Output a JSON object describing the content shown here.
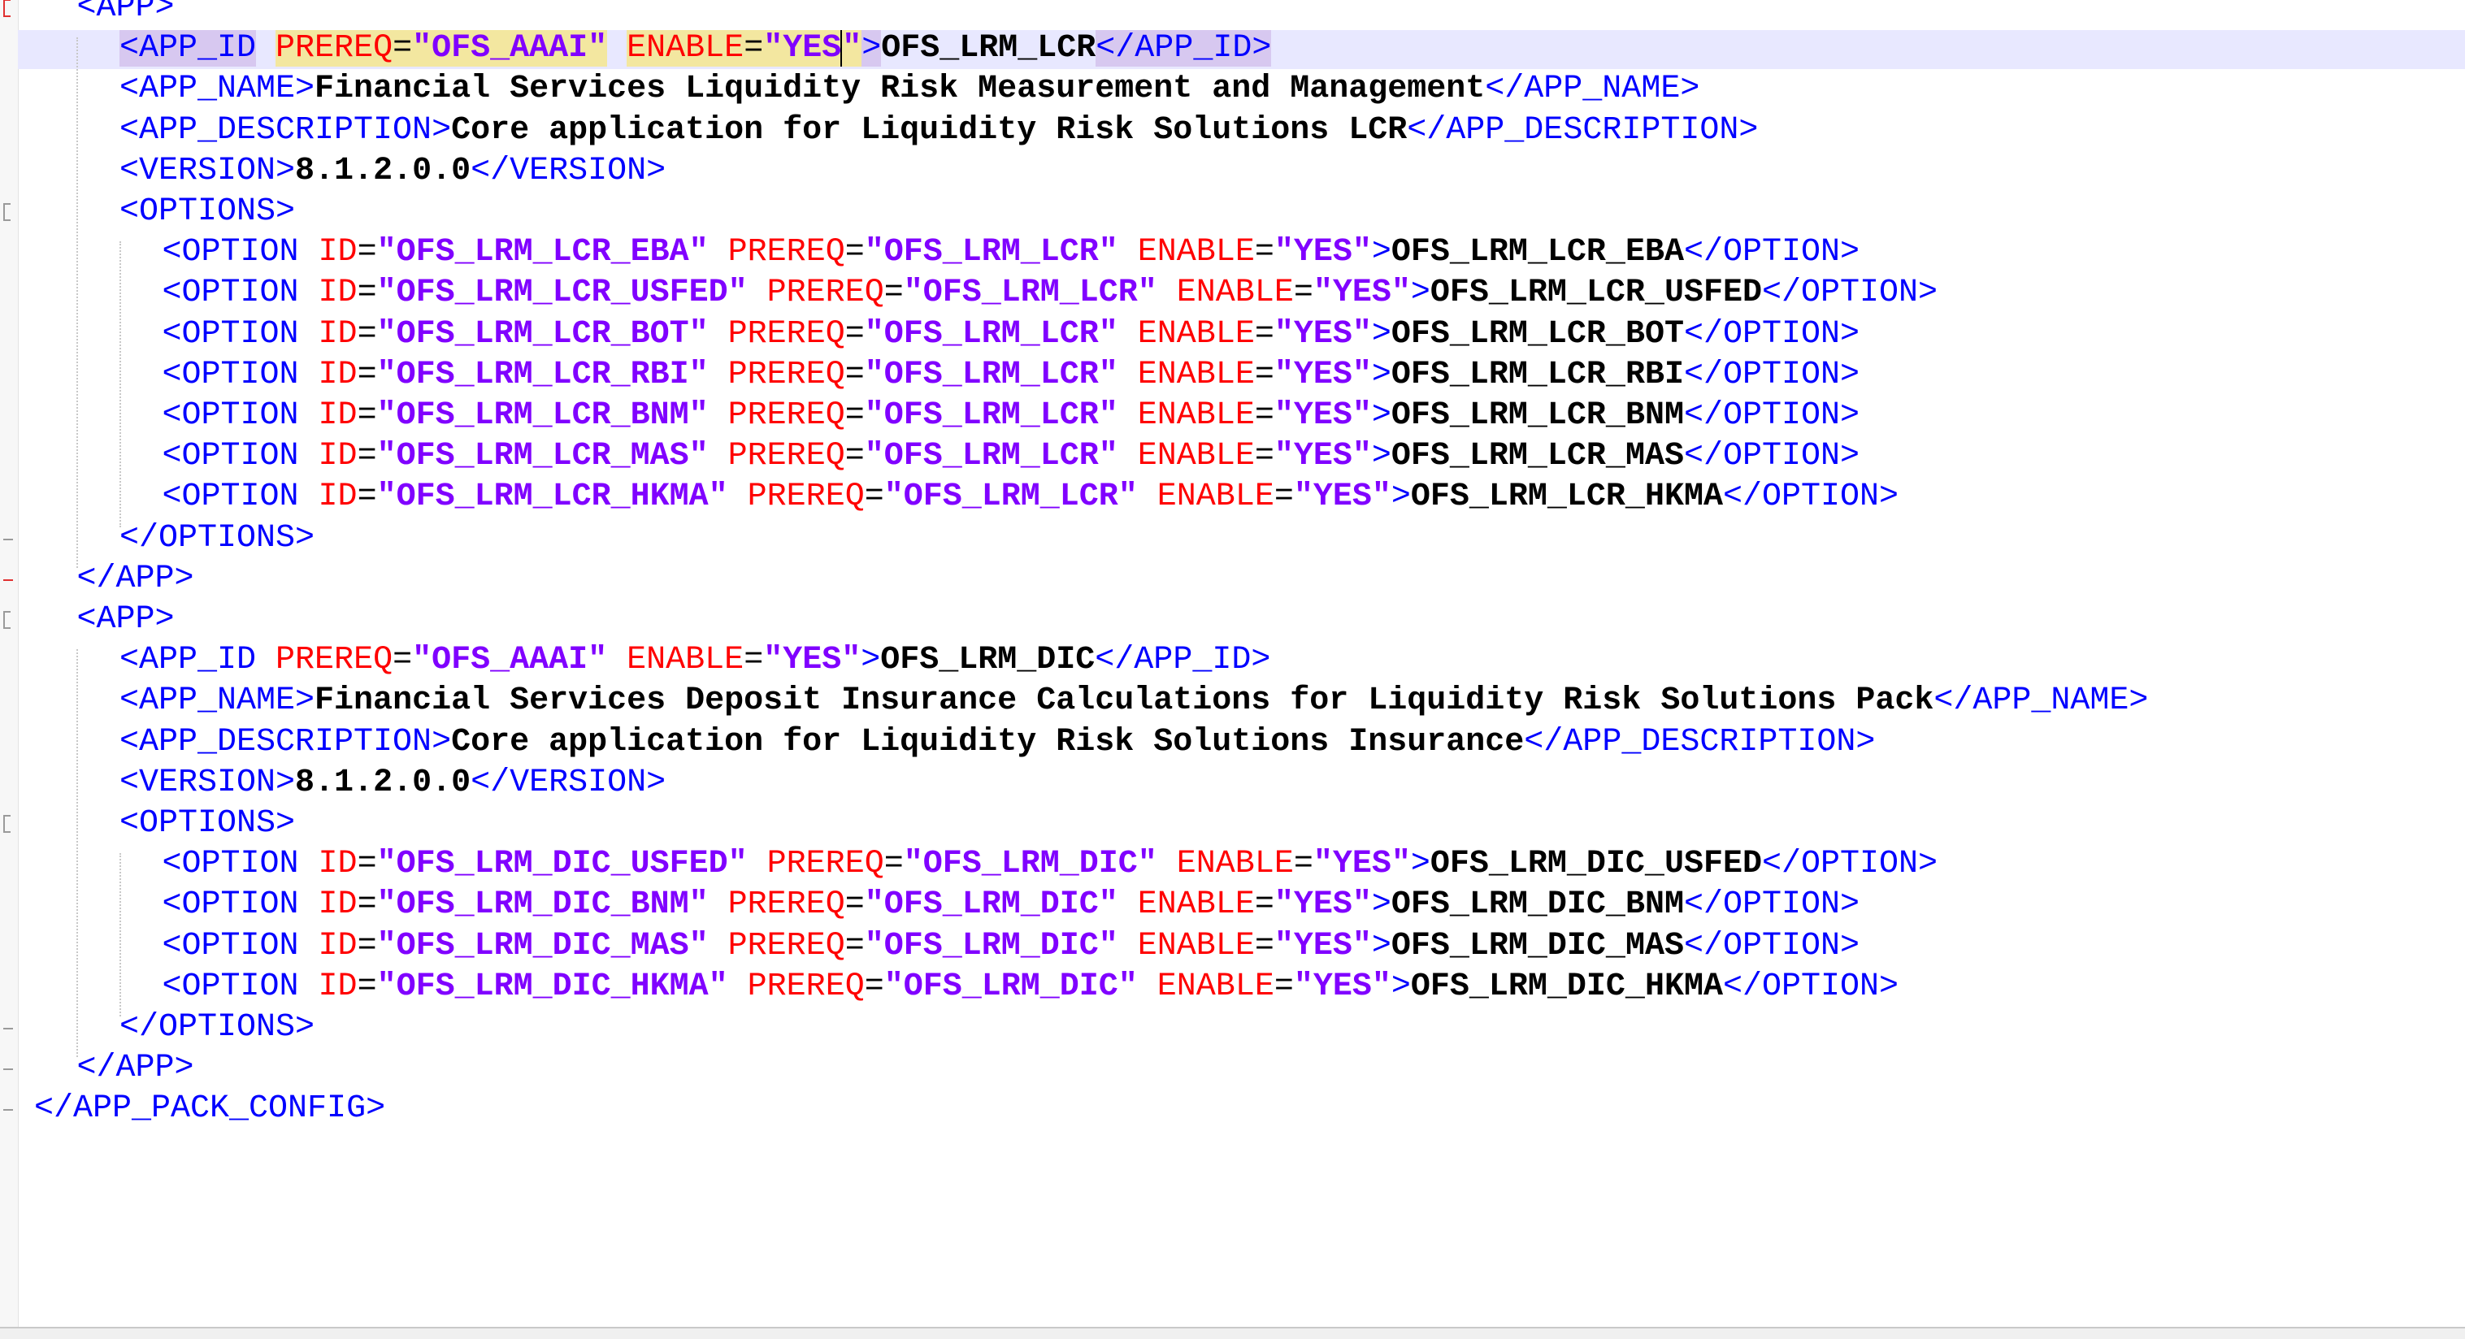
{
  "editor": {
    "lines": [
      {
        "indent": 1,
        "tokens": [
          {
            "t": "tag",
            "v": "<APP>"
          }
        ]
      },
      {
        "indent": 2,
        "current": true,
        "tokens": [
          {
            "t": "tag",
            "v": "<APP_ID",
            "hl": "tag"
          },
          {
            "t": "sp",
            "v": " "
          },
          {
            "t": "attr",
            "v": "PREREQ",
            "hl": "y"
          },
          {
            "t": "eq",
            "v": "=",
            "hl": "y"
          },
          {
            "t": "val",
            "v": "\"OFS_AAAI\"",
            "hl": "y"
          },
          {
            "t": "sp",
            "v": " "
          },
          {
            "t": "attr",
            "v": "ENABLE",
            "hl": "y"
          },
          {
            "t": "eq",
            "v": "=",
            "hl": "y"
          },
          {
            "t": "val",
            "v": "\"YES",
            "hl": "y"
          },
          {
            "t": "val",
            "v": "\"",
            "hl": "y",
            "caret": true
          },
          {
            "t": "tag",
            "v": ">",
            "hl": "tag"
          },
          {
            "t": "text",
            "v": "OFS_LRM_LCR"
          },
          {
            "t": "tag",
            "v": "</APP_ID>",
            "hl": "tag"
          }
        ]
      },
      {
        "indent": 2,
        "tokens": [
          {
            "t": "tag",
            "v": "<APP_NAME>"
          },
          {
            "t": "text",
            "v": "Financial Services Liquidity Risk Measurement and Management"
          },
          {
            "t": "tag",
            "v": "</APP_NAME>"
          }
        ]
      },
      {
        "indent": 2,
        "tokens": [
          {
            "t": "tag",
            "v": "<APP_DESCRIPTION>"
          },
          {
            "t": "text",
            "v": "Core application for Liquidity Risk Solutions LCR"
          },
          {
            "t": "tag",
            "v": "</APP_DESCRIPTION>"
          }
        ]
      },
      {
        "indent": 2,
        "tokens": [
          {
            "t": "tag",
            "v": "<VERSION>"
          },
          {
            "t": "text",
            "v": "8.1.2.0.0"
          },
          {
            "t": "tag",
            "v": "</VERSION>"
          }
        ]
      },
      {
        "indent": 2,
        "tokens": [
          {
            "t": "tag",
            "v": "<OPTIONS>"
          }
        ]
      },
      {
        "indent": 3,
        "tokens": [
          {
            "t": "tag",
            "v": "<OPTION"
          },
          {
            "t": "sp",
            "v": " "
          },
          {
            "t": "attr",
            "v": "ID"
          },
          {
            "t": "eq",
            "v": "="
          },
          {
            "t": "val",
            "v": "\"OFS_LRM_LCR_EBA\""
          },
          {
            "t": "sp",
            "v": " "
          },
          {
            "t": "attr",
            "v": "PREREQ"
          },
          {
            "t": "eq",
            "v": "="
          },
          {
            "t": "val",
            "v": "\"OFS_LRM_LCR\""
          },
          {
            "t": "sp",
            "v": " "
          },
          {
            "t": "attr",
            "v": "ENABLE"
          },
          {
            "t": "eq",
            "v": "="
          },
          {
            "t": "val",
            "v": "\"YES\""
          },
          {
            "t": "tag",
            "v": ">"
          },
          {
            "t": "text",
            "v": "OFS_LRM_LCR_EBA"
          },
          {
            "t": "tag",
            "v": "</OPTION>"
          }
        ]
      },
      {
        "indent": 3,
        "tokens": [
          {
            "t": "tag",
            "v": "<OPTION"
          },
          {
            "t": "sp",
            "v": " "
          },
          {
            "t": "attr",
            "v": "ID"
          },
          {
            "t": "eq",
            "v": "="
          },
          {
            "t": "val",
            "v": "\"OFS_LRM_LCR_USFED\""
          },
          {
            "t": "sp",
            "v": " "
          },
          {
            "t": "attr",
            "v": "PREREQ"
          },
          {
            "t": "eq",
            "v": "="
          },
          {
            "t": "val",
            "v": "\"OFS_LRM_LCR\""
          },
          {
            "t": "sp",
            "v": " "
          },
          {
            "t": "attr",
            "v": "ENABLE"
          },
          {
            "t": "eq",
            "v": "="
          },
          {
            "t": "val",
            "v": "\"YES\""
          },
          {
            "t": "tag",
            "v": ">"
          },
          {
            "t": "text",
            "v": "OFS_LRM_LCR_USFED"
          },
          {
            "t": "tag",
            "v": "</OPTION>"
          }
        ]
      },
      {
        "indent": 3,
        "tokens": [
          {
            "t": "tag",
            "v": "<OPTION"
          },
          {
            "t": "sp",
            "v": " "
          },
          {
            "t": "attr",
            "v": "ID"
          },
          {
            "t": "eq",
            "v": "="
          },
          {
            "t": "val",
            "v": "\"OFS_LRM_LCR_BOT\""
          },
          {
            "t": "sp",
            "v": " "
          },
          {
            "t": "attr",
            "v": "PREREQ"
          },
          {
            "t": "eq",
            "v": "="
          },
          {
            "t": "val",
            "v": "\"OFS_LRM_LCR\""
          },
          {
            "t": "sp",
            "v": " "
          },
          {
            "t": "attr",
            "v": "ENABLE"
          },
          {
            "t": "eq",
            "v": "="
          },
          {
            "t": "val",
            "v": "\"YES\""
          },
          {
            "t": "tag",
            "v": ">"
          },
          {
            "t": "text",
            "v": "OFS_LRM_LCR_BOT"
          },
          {
            "t": "tag",
            "v": "</OPTION>"
          }
        ]
      },
      {
        "indent": 3,
        "tokens": [
          {
            "t": "tag",
            "v": "<OPTION"
          },
          {
            "t": "sp",
            "v": " "
          },
          {
            "t": "attr",
            "v": "ID"
          },
          {
            "t": "eq",
            "v": "="
          },
          {
            "t": "val",
            "v": "\"OFS_LRM_LCR_RBI\""
          },
          {
            "t": "sp",
            "v": " "
          },
          {
            "t": "attr",
            "v": "PREREQ"
          },
          {
            "t": "eq",
            "v": "="
          },
          {
            "t": "val",
            "v": "\"OFS_LRM_LCR\""
          },
          {
            "t": "sp",
            "v": " "
          },
          {
            "t": "attr",
            "v": "ENABLE"
          },
          {
            "t": "eq",
            "v": "="
          },
          {
            "t": "val",
            "v": "\"YES\""
          },
          {
            "t": "tag",
            "v": ">"
          },
          {
            "t": "text",
            "v": "OFS_LRM_LCR_RBI"
          },
          {
            "t": "tag",
            "v": "</OPTION>"
          }
        ]
      },
      {
        "indent": 3,
        "tokens": [
          {
            "t": "tag",
            "v": "<OPTION"
          },
          {
            "t": "sp",
            "v": " "
          },
          {
            "t": "attr",
            "v": "ID"
          },
          {
            "t": "eq",
            "v": "="
          },
          {
            "t": "val",
            "v": "\"OFS_LRM_LCR_BNM\""
          },
          {
            "t": "sp",
            "v": " "
          },
          {
            "t": "attr",
            "v": "PREREQ"
          },
          {
            "t": "eq",
            "v": "="
          },
          {
            "t": "val",
            "v": "\"OFS_LRM_LCR\""
          },
          {
            "t": "sp",
            "v": " "
          },
          {
            "t": "attr",
            "v": "ENABLE"
          },
          {
            "t": "eq",
            "v": "="
          },
          {
            "t": "val",
            "v": "\"YES\""
          },
          {
            "t": "tag",
            "v": ">"
          },
          {
            "t": "text",
            "v": "OFS_LRM_LCR_BNM"
          },
          {
            "t": "tag",
            "v": "</OPTION>"
          }
        ]
      },
      {
        "indent": 3,
        "tokens": [
          {
            "t": "tag",
            "v": "<OPTION"
          },
          {
            "t": "sp",
            "v": " "
          },
          {
            "t": "attr",
            "v": "ID"
          },
          {
            "t": "eq",
            "v": "="
          },
          {
            "t": "val",
            "v": "\"OFS_LRM_LCR_MAS\""
          },
          {
            "t": "sp",
            "v": " "
          },
          {
            "t": "attr",
            "v": "PREREQ"
          },
          {
            "t": "eq",
            "v": "="
          },
          {
            "t": "val",
            "v": "\"OFS_LRM_LCR\""
          },
          {
            "t": "sp",
            "v": " "
          },
          {
            "t": "attr",
            "v": "ENABLE"
          },
          {
            "t": "eq",
            "v": "="
          },
          {
            "t": "val",
            "v": "\"YES\""
          },
          {
            "t": "tag",
            "v": ">"
          },
          {
            "t": "text",
            "v": "OFS_LRM_LCR_MAS"
          },
          {
            "t": "tag",
            "v": "</OPTION>"
          }
        ]
      },
      {
        "indent": 3,
        "tokens": [
          {
            "t": "tag",
            "v": "<OPTION"
          },
          {
            "t": "sp",
            "v": " "
          },
          {
            "t": "attr",
            "v": "ID"
          },
          {
            "t": "eq",
            "v": "="
          },
          {
            "t": "val",
            "v": "\"OFS_LRM_LCR_HKMA\""
          },
          {
            "t": "sp",
            "v": " "
          },
          {
            "t": "attr",
            "v": "PREREQ"
          },
          {
            "t": "eq",
            "v": "="
          },
          {
            "t": "val",
            "v": "\"OFS_LRM_LCR\""
          },
          {
            "t": "sp",
            "v": " "
          },
          {
            "t": "attr",
            "v": "ENABLE"
          },
          {
            "t": "eq",
            "v": "="
          },
          {
            "t": "val",
            "v": "\"YES\""
          },
          {
            "t": "tag",
            "v": ">"
          },
          {
            "t": "text",
            "v": "OFS_LRM_LCR_HKMA"
          },
          {
            "t": "tag",
            "v": "</OPTION>"
          }
        ]
      },
      {
        "indent": 2,
        "tokens": [
          {
            "t": "tag",
            "v": "</OPTIONS>"
          }
        ]
      },
      {
        "indent": 1,
        "tokens": [
          {
            "t": "tag",
            "v": "</APP>"
          }
        ]
      },
      {
        "indent": 1,
        "tokens": [
          {
            "t": "tag",
            "v": "<APP>"
          }
        ]
      },
      {
        "indent": 2,
        "tokens": [
          {
            "t": "tag",
            "v": "<APP_ID"
          },
          {
            "t": "sp",
            "v": " "
          },
          {
            "t": "attr",
            "v": "PREREQ"
          },
          {
            "t": "eq",
            "v": "="
          },
          {
            "t": "val",
            "v": "\"OFS_AAAI\""
          },
          {
            "t": "sp",
            "v": " "
          },
          {
            "t": "attr",
            "v": "ENABLE"
          },
          {
            "t": "eq",
            "v": "="
          },
          {
            "t": "val",
            "v": "\"YES\""
          },
          {
            "t": "tag",
            "v": ">"
          },
          {
            "t": "text",
            "v": "OFS_LRM_DIC"
          },
          {
            "t": "tag",
            "v": "</APP_ID>"
          }
        ]
      },
      {
        "indent": 2,
        "tokens": [
          {
            "t": "tag",
            "v": "<APP_NAME>"
          },
          {
            "t": "text",
            "v": "Financial Services Deposit Insurance Calculations for Liquidity Risk Solutions Pack"
          },
          {
            "t": "tag",
            "v": "</APP_NAME>"
          }
        ]
      },
      {
        "indent": 2,
        "tokens": [
          {
            "t": "tag",
            "v": "<APP_DESCRIPTION>"
          },
          {
            "t": "text",
            "v": "Core application for Liquidity Risk Solutions Insurance"
          },
          {
            "t": "tag",
            "v": "</APP_DESCRIPTION>"
          }
        ]
      },
      {
        "indent": 2,
        "tokens": [
          {
            "t": "tag",
            "v": "<VERSION>"
          },
          {
            "t": "text",
            "v": "8.1.2.0.0"
          },
          {
            "t": "tag",
            "v": "</VERSION>"
          }
        ]
      },
      {
        "indent": 2,
        "tokens": [
          {
            "t": "tag",
            "v": "<OPTIONS>"
          }
        ]
      },
      {
        "indent": 3,
        "tokens": [
          {
            "t": "tag",
            "v": "<OPTION"
          },
          {
            "t": "sp",
            "v": " "
          },
          {
            "t": "attr",
            "v": "ID"
          },
          {
            "t": "eq",
            "v": "="
          },
          {
            "t": "val",
            "v": "\"OFS_LRM_DIC_USFED\""
          },
          {
            "t": "sp",
            "v": " "
          },
          {
            "t": "attr",
            "v": "PREREQ"
          },
          {
            "t": "eq",
            "v": "="
          },
          {
            "t": "val",
            "v": "\"OFS_LRM_DIC\""
          },
          {
            "t": "sp",
            "v": " "
          },
          {
            "t": "attr",
            "v": "ENABLE"
          },
          {
            "t": "eq",
            "v": "="
          },
          {
            "t": "val",
            "v": "\"YES\""
          },
          {
            "t": "tag",
            "v": ">"
          },
          {
            "t": "text",
            "v": "OFS_LRM_DIC_USFED"
          },
          {
            "t": "tag",
            "v": "</OPTION>"
          }
        ]
      },
      {
        "indent": 3,
        "tokens": [
          {
            "t": "tag",
            "v": "<OPTION"
          },
          {
            "t": "sp",
            "v": " "
          },
          {
            "t": "attr",
            "v": "ID"
          },
          {
            "t": "eq",
            "v": "="
          },
          {
            "t": "val",
            "v": "\"OFS_LRM_DIC_BNM\""
          },
          {
            "t": "sp",
            "v": " "
          },
          {
            "t": "attr",
            "v": "PREREQ"
          },
          {
            "t": "eq",
            "v": "="
          },
          {
            "t": "val",
            "v": "\"OFS_LRM_DIC\""
          },
          {
            "t": "sp",
            "v": " "
          },
          {
            "t": "attr",
            "v": "ENABLE"
          },
          {
            "t": "eq",
            "v": "="
          },
          {
            "t": "val",
            "v": "\"YES\""
          },
          {
            "t": "tag",
            "v": ">"
          },
          {
            "t": "text",
            "v": "OFS_LRM_DIC_BNM"
          },
          {
            "t": "tag",
            "v": "</OPTION>"
          }
        ]
      },
      {
        "indent": 3,
        "tokens": [
          {
            "t": "tag",
            "v": "<OPTION"
          },
          {
            "t": "sp",
            "v": " "
          },
          {
            "t": "attr",
            "v": "ID"
          },
          {
            "t": "eq",
            "v": "="
          },
          {
            "t": "val",
            "v": "\"OFS_LRM_DIC_MAS\""
          },
          {
            "t": "sp",
            "v": " "
          },
          {
            "t": "attr",
            "v": "PREREQ"
          },
          {
            "t": "eq",
            "v": "="
          },
          {
            "t": "val",
            "v": "\"OFS_LRM_DIC\""
          },
          {
            "t": "sp",
            "v": " "
          },
          {
            "t": "attr",
            "v": "ENABLE"
          },
          {
            "t": "eq",
            "v": "="
          },
          {
            "t": "val",
            "v": "\"YES\""
          },
          {
            "t": "tag",
            "v": ">"
          },
          {
            "t": "text",
            "v": "OFS_LRM_DIC_MAS"
          },
          {
            "t": "tag",
            "v": "</OPTION>"
          }
        ]
      },
      {
        "indent": 3,
        "tokens": [
          {
            "t": "tag",
            "v": "<OPTION"
          },
          {
            "t": "sp",
            "v": " "
          },
          {
            "t": "attr",
            "v": "ID"
          },
          {
            "t": "eq",
            "v": "="
          },
          {
            "t": "val",
            "v": "\"OFS_LRM_DIC_HKMA\""
          },
          {
            "t": "sp",
            "v": " "
          },
          {
            "t": "attr",
            "v": "PREREQ"
          },
          {
            "t": "eq",
            "v": "="
          },
          {
            "t": "val",
            "v": "\"OFS_LRM_DIC\""
          },
          {
            "t": "sp",
            "v": " "
          },
          {
            "t": "attr",
            "v": "ENABLE"
          },
          {
            "t": "eq",
            "v": "="
          },
          {
            "t": "val",
            "v": "\"YES\""
          },
          {
            "t": "tag",
            "v": ">"
          },
          {
            "t": "text",
            "v": "OFS_LRM_DIC_HKMA"
          },
          {
            "t": "tag",
            "v": "</OPTION>"
          }
        ]
      },
      {
        "indent": 2,
        "tokens": [
          {
            "t": "tag",
            "v": "</OPTIONS>"
          }
        ]
      },
      {
        "indent": 1,
        "tokens": [
          {
            "t": "tag",
            "v": "</APP>"
          }
        ]
      },
      {
        "indent": 0,
        "tokens": [
          {
            "t": "tag",
            "v": "</APP_PACK_CONFIG>"
          }
        ]
      }
    ]
  },
  "colors": {
    "tag": "#0000ff",
    "attribute": "#ff0000",
    "value": "#8000ff",
    "text": "#000000",
    "current_line": "#e8e8ff",
    "match_highlight": "#f3e7a0",
    "tag_highlight": "#d7c8f0"
  }
}
